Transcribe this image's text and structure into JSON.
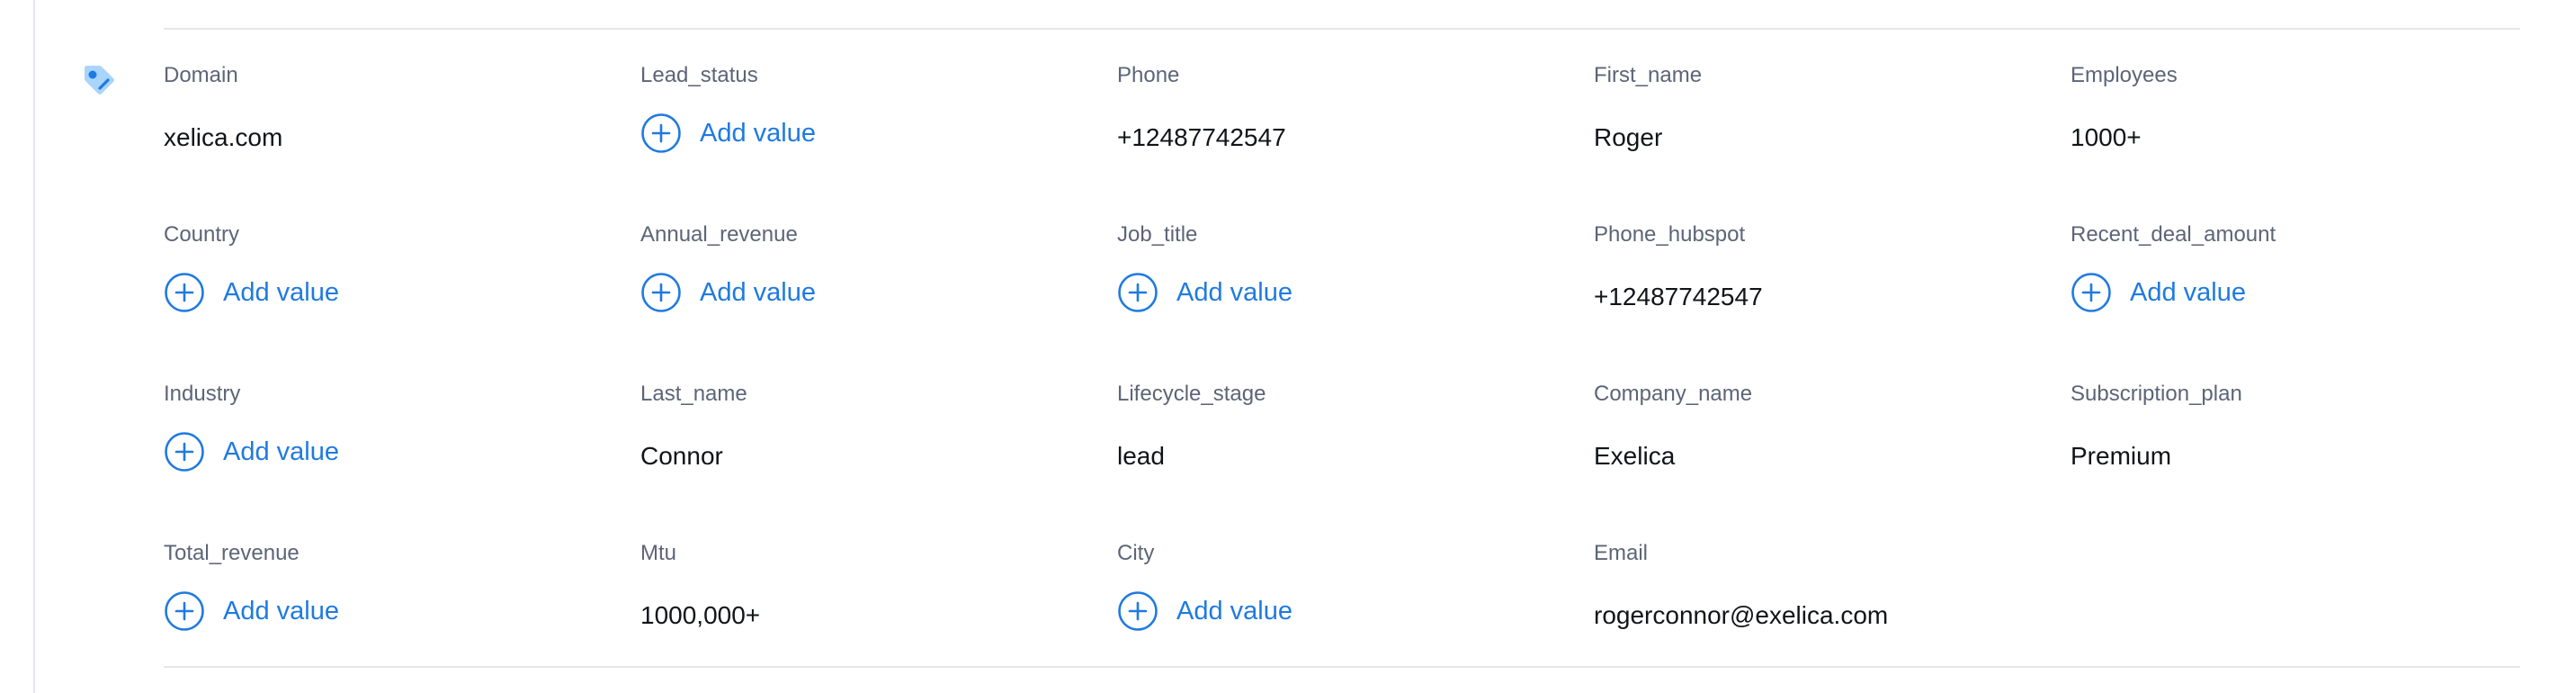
{
  "colors": {
    "accent": "#1f7ae0",
    "label": "#5c6577",
    "value": "#111418",
    "divider": "#e5e7eb",
    "tag_icon": "#3b9cf0"
  },
  "icons": {
    "section": "tag-icon",
    "add": "plus-circle-icon"
  },
  "add_value_label": "Add value",
  "fields": [
    {
      "label": "Domain",
      "value": "xelica.com"
    },
    {
      "label": "Lead_status",
      "value": null
    },
    {
      "label": "Phone",
      "value": "+12487742547"
    },
    {
      "label": "First_name",
      "value": "Roger"
    },
    {
      "label": "Employees",
      "value": "1000+"
    },
    {
      "label": "Country",
      "value": null
    },
    {
      "label": "Annual_revenue",
      "value": null
    },
    {
      "label": "Job_title",
      "value": null
    },
    {
      "label": "Phone_hubspot",
      "value": "+12487742547"
    },
    {
      "label": "Recent_deal_amount",
      "value": null
    },
    {
      "label": "Industry",
      "value": null
    },
    {
      "label": "Last_name",
      "value": "Connor"
    },
    {
      "label": "Lifecycle_stage",
      "value": "lead"
    },
    {
      "label": "Company_name",
      "value": "Exelica"
    },
    {
      "label": "Subscription_plan",
      "value": "Premium"
    },
    {
      "label": "Total_revenue",
      "value": null
    },
    {
      "label": "Mtu",
      "value": "1000,000+"
    },
    {
      "label": "City",
      "value": null
    },
    {
      "label": "Email",
      "value": "rogerconnor@exelica.com"
    }
  ]
}
